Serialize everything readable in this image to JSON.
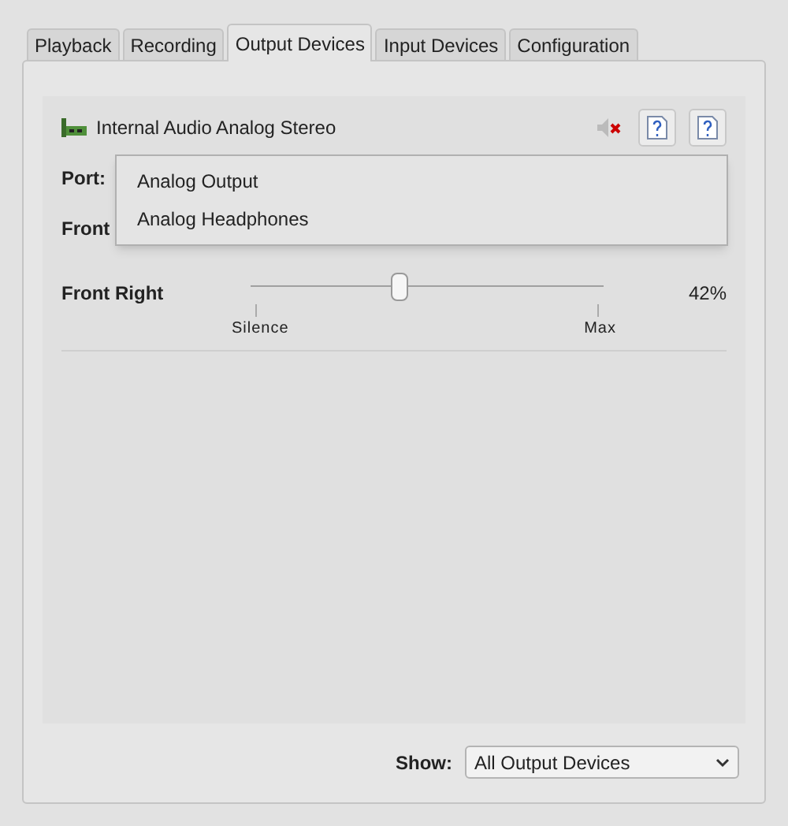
{
  "tabs": [
    {
      "label": "Playback",
      "selected": false
    },
    {
      "label": "Recording",
      "selected": false
    },
    {
      "label": "Output Devices",
      "selected": true
    },
    {
      "label": "Input Devices",
      "selected": false
    },
    {
      "label": "Configuration",
      "selected": false
    }
  ],
  "device": {
    "name": "Internal Audio Analog Stereo",
    "muted": true
  },
  "port": {
    "label": "Port:",
    "options": [
      {
        "label": "Analog Output",
        "selected": false
      },
      {
        "label": "Analog Headphones",
        "selected": false
      }
    ]
  },
  "channels": [
    {
      "name": "Front"
    },
    {
      "name": "Front Right",
      "level": 0.42,
      "reading": "42%",
      "min_label": "Silence",
      "max_label": "Max"
    }
  ],
  "show": {
    "label": "Show:",
    "value": "All Output Devices"
  }
}
